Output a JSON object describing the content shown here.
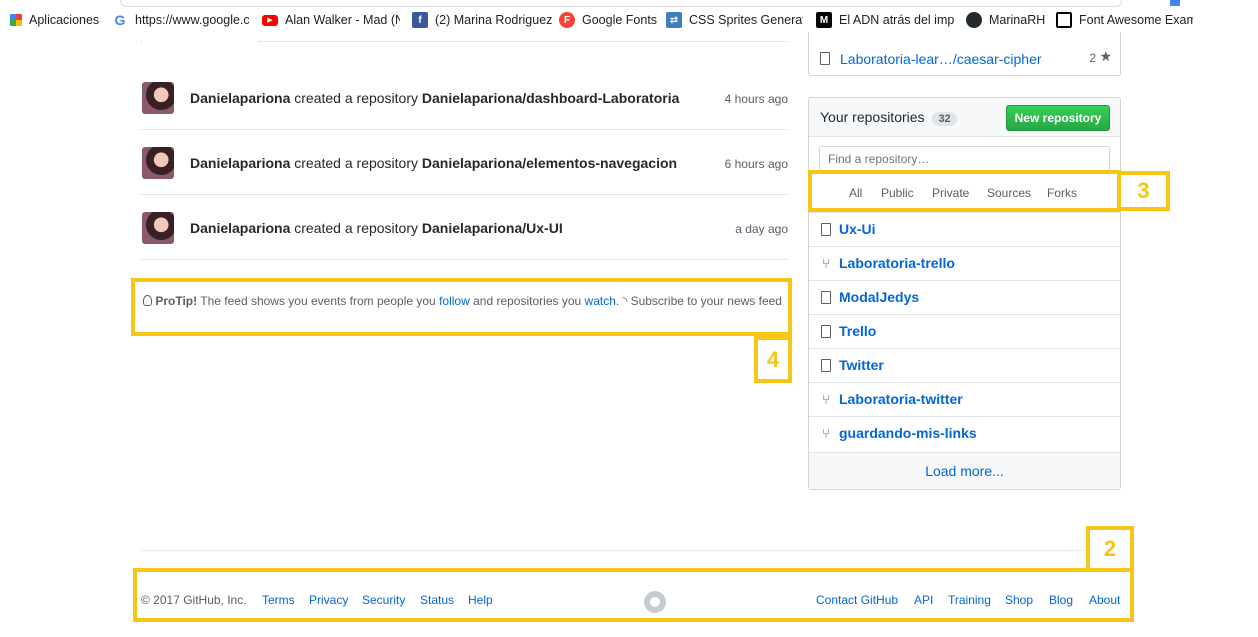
{
  "bookmarks": [
    {
      "label": "Aplicaciones",
      "icon": "apps-grid-icon"
    },
    {
      "label": "https://www.google.c",
      "icon": "google-icon"
    },
    {
      "label": "Alan Walker - Mad (N",
      "icon": "youtube-icon"
    },
    {
      "label": "(2) Marina Rodriguez",
      "icon": "facebook-icon"
    },
    {
      "label": "Google Fonts",
      "icon": "google-fonts-icon"
    },
    {
      "label": "CSS Sprites Generato",
      "icon": "css-sprites-icon"
    },
    {
      "label": "El ADN atrás del imp",
      "icon": "medium-icon"
    },
    {
      "label": "MarinaRH",
      "icon": "github-icon"
    },
    {
      "label": "Font Awesome Examp",
      "icon": "font-awesome-icon"
    }
  ],
  "top_repo": {
    "name": "Laboratoria-lear…/caesar-cipher",
    "stars": "2"
  },
  "feed": [
    {
      "user": "Danielapariona",
      "action": "created a repository",
      "repo": "Danielapariona/dashboard-Laboratoria",
      "time": "4 hours ago"
    },
    {
      "user": "Danielapariona",
      "action": "created a repository",
      "repo": "Danielapariona/elementos-navegacion",
      "time": "6 hours ago"
    },
    {
      "user": "Danielapariona",
      "action": "created a repository",
      "repo": "Danielapariona/Ux-UI",
      "time": "a day ago"
    }
  ],
  "protip": {
    "label": "ProTip!",
    "text1": "The feed shows you events from people you",
    "follow": "follow",
    "text2": "and repositories you",
    "watch": "watch.",
    "subscribe": "Subscribe to your news feed"
  },
  "repos_panel": {
    "title": "Your repositories",
    "count": "32",
    "new_button": "New repository",
    "filter_placeholder": "Find a repository…",
    "filters": [
      "All",
      "Public",
      "Private",
      "Sources",
      "Forks"
    ],
    "repos": [
      {
        "name": "Ux-Ui",
        "type": "repo"
      },
      {
        "name": "Laboratoria-trello",
        "type": "fork"
      },
      {
        "name": "ModalJedys",
        "type": "repo"
      },
      {
        "name": "Trello",
        "type": "repo"
      },
      {
        "name": "Twitter",
        "type": "repo"
      },
      {
        "name": "Laboratoria-twitter",
        "type": "fork"
      },
      {
        "name": "guardando-mis-links",
        "type": "fork"
      }
    ],
    "load_more": "Load more..."
  },
  "footer": {
    "copyright": "© 2017 GitHub, Inc.",
    "left_links": [
      "Terms",
      "Privacy",
      "Security",
      "Status",
      "Help"
    ],
    "right_links": [
      "Contact GitHub",
      "API",
      "Training",
      "Shop",
      "Blog",
      "About"
    ]
  },
  "annotations": {
    "n2": "2",
    "n3": "3",
    "n4": "4"
  },
  "colors": {
    "highlight": "#f5c518",
    "link": "#0366d6",
    "green": "#28a745"
  }
}
